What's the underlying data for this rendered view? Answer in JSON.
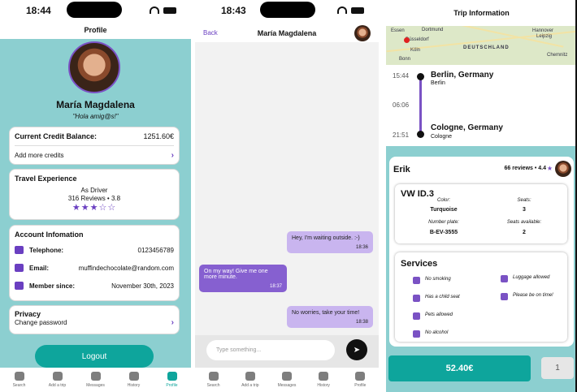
{
  "profile": {
    "time": "18:44",
    "title": "Profile",
    "name": "María Magdalena",
    "quote": "\"Hola amig@s!\"",
    "credit": {
      "label": "Current Credit Balance:",
      "value": "1251.60€",
      "add": "Add more credits"
    },
    "travel": {
      "title": "Travel Experience",
      "role": "As Driver",
      "reviews": "316 Reviews • 3.8",
      "rating_of_5": 3
    },
    "account": {
      "title": "Account Infomation",
      "telephone_label": "Telephone:",
      "telephone": "0123456789",
      "email_label": "Email:",
      "email": "muffindechocolate@random.com",
      "member_label": "Member since:",
      "member": "November 30th, 2023"
    },
    "privacy": {
      "title": "Privacy",
      "change": "Change password"
    },
    "logout": "Logout"
  },
  "tabs": [
    "Search",
    "Add a trip",
    "Messages",
    "History",
    "Profile"
  ],
  "chat": {
    "time": "18:43",
    "back": "Back",
    "title": "María Magdalena",
    "messages": [
      {
        "text": "Hey, I'm waiting outside. :-)",
        "time": "18:36",
        "dir": "in"
      },
      {
        "text": "On my way! Give me one more minute.",
        "time": "18:37",
        "dir": "out"
      },
      {
        "text": "No worries, take your time!",
        "time": "18:38",
        "dir": "in"
      }
    ],
    "placeholder": "Type something..."
  },
  "trip": {
    "title": "Trip Information",
    "map_labels": [
      "Essen",
      "Dortmund",
      "Hannover",
      "Düsseldorf",
      "Köln",
      "Leipzig",
      "DEUTSCHLAND",
      "Bonn",
      "Chemnitz"
    ],
    "from": {
      "time": "15:44",
      "city": "Berlin, Germany",
      "short": "Berlin"
    },
    "duration": "06:06",
    "to": {
      "time": "21:51",
      "city": "Cologne, Germany",
      "short": "Cologne"
    },
    "driver": {
      "name": "Erik",
      "reviews": "66 reviews • 4.4"
    },
    "car": {
      "model": "VW ID.3",
      "color_label": "Color:",
      "color": "Turquoise",
      "seats_label": "Seats:",
      "seats": "3",
      "plate_label": "Number plate:",
      "plate": "B-EV-3555",
      "avail_label": "Seats available:",
      "avail": "2"
    },
    "services_title": "Services",
    "services": [
      "No smoking",
      "Luggage allowed",
      "Has a child seat",
      "Please be on time!",
      "Pets allowed",
      "No alcohol"
    ],
    "price": "52.40€",
    "quantity": "1"
  },
  "colors": {
    "teal": "#0ea59c",
    "mint": "#8ccfd0",
    "purple": "#7a52c4"
  }
}
